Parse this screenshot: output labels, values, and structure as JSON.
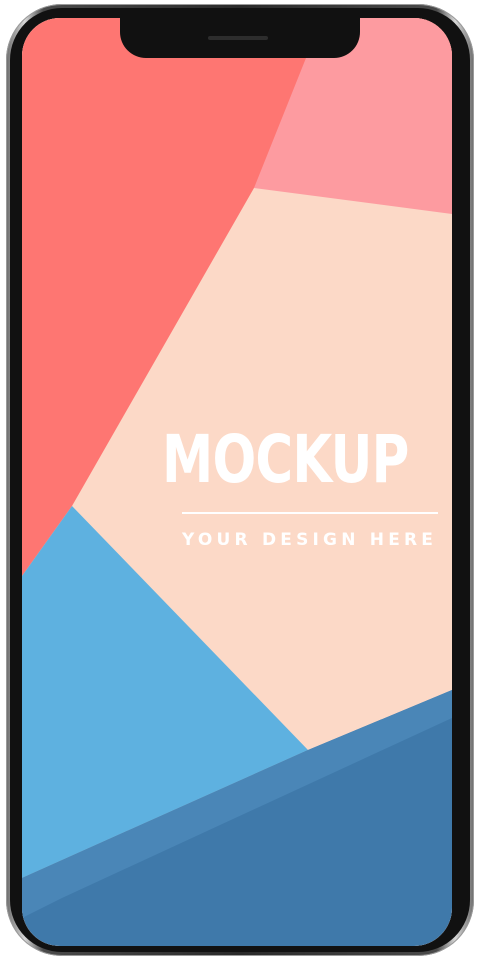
{
  "device": {
    "frame_color": "#1a1a1a"
  },
  "screen": {
    "colors": {
      "coral": "#fe7672",
      "pink": "#fd9ba0",
      "peach": "#fcd9c7",
      "light_blue": "#5eb1e0",
      "mid_blue": "#4a86b7",
      "dark_blue": "#3c77a8"
    },
    "title": "MOCKUP",
    "subtitle": "YOUR DESIGN HERE"
  }
}
